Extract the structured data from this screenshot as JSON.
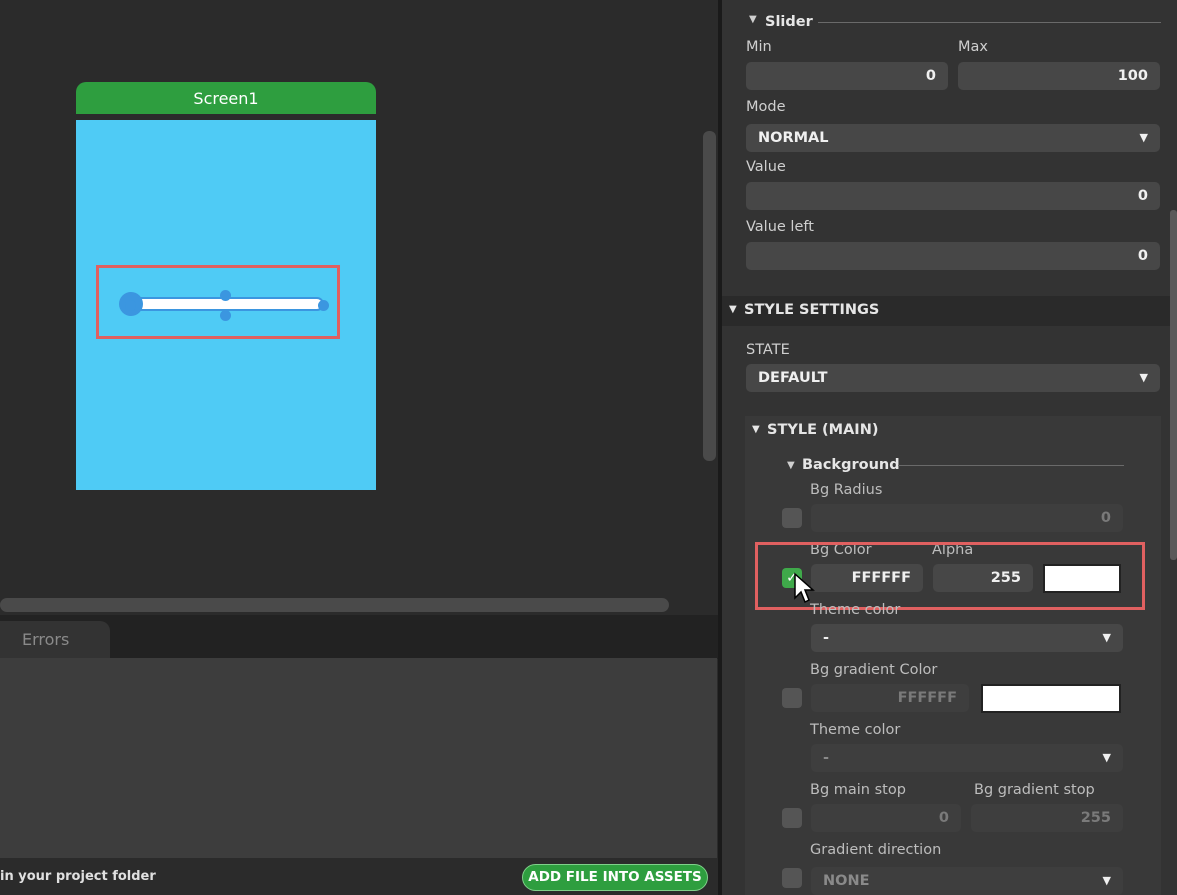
{
  "canvas": {
    "screen_tab_label": "Screen1",
    "screen_bg_color": "#4fcbf5",
    "accent_color": "#2e9e3f"
  },
  "bottom": {
    "tab_errors": "Errors",
    "footer_text": "in your project folder",
    "add_button": "ADD FILE INTO ASSETS"
  },
  "slider_section": {
    "title": "Slider",
    "min_label": "Min",
    "min_value": "0",
    "max_label": "Max",
    "max_value": "100",
    "mode_label": "Mode",
    "mode_value": "NORMAL",
    "value_label": "Value",
    "value_value": "0",
    "value_left_label": "Value left",
    "value_left_value": "0"
  },
  "style_settings": {
    "title": "STYLE SETTINGS",
    "state_label": "STATE",
    "state_value": "DEFAULT",
    "style_main_title": "STYLE (MAIN)",
    "background_title": "Background",
    "bg_radius_label": "Bg Radius",
    "bg_radius_value": "0",
    "bg_color_label": "Bg Color",
    "bg_color_value": "FFFFFF",
    "alpha_label": "Alpha",
    "alpha_value": "255",
    "theme_color_label": "Theme color",
    "theme_color_value": "-",
    "bg_gradient_label": "Bg gradient Color",
    "bg_gradient_value": "FFFFFF",
    "theme_color2_label": "Theme color",
    "theme_color2_value": "-",
    "bg_main_stop_label": "Bg main stop",
    "bg_main_stop_value": "0",
    "bg_gradient_stop_label": "Bg gradient stop",
    "bg_gradient_stop_value": "255",
    "gradient_direction_label": "Gradient direction",
    "gradient_direction_value": "NONE"
  }
}
